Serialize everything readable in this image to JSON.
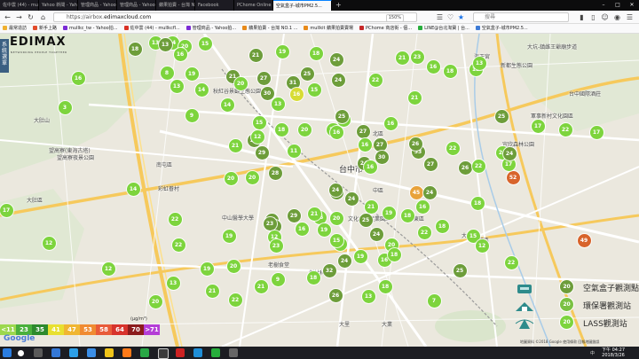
{
  "browser": {
    "tabs": [
      {
        "label": "佐中雲 (44) - mullkcha@g..."
      },
      {
        "label": "Yahoo 新聞 - Yahoo新聞..."
      },
      {
        "label": "管理商品 - Yahoo拍賣..."
      },
      {
        "label": "管理商品 - Yahoo拍賣..."
      },
      {
        "label": "蘋果拍賣 - 台灣 NO.1 拍賣..."
      },
      {
        "label": "Facebook"
      },
      {
        "label": "PChome Online 網路家庭..."
      },
      {
        "label": "空氣盒子-城市PM2.5...",
        "active": true
      }
    ],
    "url_prefix": "https://airbox.",
    "url_host": "edimaxcloud.com",
    "zoom": "150%",
    "search_placeholder": "搜尋",
    "bookmarks": [
      {
        "label": "最常造訪",
        "color": "#f0b030"
      },
      {
        "label": "新手上路",
        "color": "#e24b2b"
      },
      {
        "label": "mullkc_tw - Yahoo拍...",
        "color": "#7b2bd6"
      },
      {
        "label": "佐中雲 (44) - mullkcfl...",
        "color": "#d93025"
      },
      {
        "label": "管理商品 - Yahoo拍...",
        "color": "#7b2bd6"
      },
      {
        "label": "蘋果拍賣 - 台灣 NO.1 ...",
        "color": "#e88a1a"
      },
      {
        "label": "mullkit 蘋果拍賣賣場",
        "color": "#e88a1a"
      },
      {
        "label": "PChome 商店街 - 個...",
        "color": "#c62828"
      },
      {
        "label": "LINE@台北淘寶 | 台...",
        "color": "#27ae3c"
      },
      {
        "label": "空氣盒子-城市PM2.5...",
        "color": "#3e7bd6"
      }
    ]
  },
  "page": {
    "brand": "EDIMAX",
    "brand_tagline": "NETWORKING PEOPLE TOGETHER",
    "side_tab": "系統選單"
  },
  "map_labels": [
    {
      "text": "大坑-鎮雌王爺廟步道",
      "size": "s"
    },
    {
      "text": "新都生態公園",
      "size": "s"
    },
    {
      "text": "海天宮",
      "size": "s"
    },
    {
      "text": "台中國際酒莊",
      "size": "s"
    },
    {
      "text": "軍事新村文化園區",
      "size": "s"
    },
    {
      "text": "大肚山",
      "size": "s"
    },
    {
      "text": "望高寮(東海古塔)",
      "size": "s"
    },
    {
      "text": "望高寮夜景公園",
      "size": "s"
    },
    {
      "text": "南屯區",
      "size": "s"
    },
    {
      "text": "彩虹眷村",
      "size": "s"
    },
    {
      "text": "大肚區",
      "size": "s"
    },
    {
      "text": "台中市",
      "size": "l"
    },
    {
      "text": "北區",
      "size": "s"
    },
    {
      "text": "中區",
      "size": "s"
    },
    {
      "text": "秋紅谷景觀生態公園",
      "size": "s"
    },
    {
      "text": "中山醫學大學",
      "size": "s"
    },
    {
      "text": "文化創意產業園區",
      "size": "s"
    },
    {
      "text": "東區",
      "size": "s"
    },
    {
      "text": "大里區",
      "size": "s"
    },
    {
      "text": "大平區",
      "size": "s"
    },
    {
      "text": "老樹食堂",
      "size": "s"
    },
    {
      "text": "樹林科技",
      "size": "s"
    },
    {
      "text": "大里",
      "size": "s"
    },
    {
      "text": "宜欣森林公園",
      "size": "s"
    },
    {
      "text": "大業",
      "size": "s"
    }
  ],
  "stations": [
    {
      "v": "18",
      "t": "box"
    },
    {
      "v": "13",
      "t": "lass"
    },
    {
      "v": "14",
      "t": "lass"
    },
    {
      "v": "20",
      "t": "lass"
    },
    {
      "v": "13",
      "t": "box"
    },
    {
      "v": "16",
      "t": "lass"
    },
    {
      "v": "15",
      "t": "lass"
    },
    {
      "v": "21",
      "t": "box"
    },
    {
      "v": "19",
      "t": "lass"
    },
    {
      "v": "18",
      "t": "lass"
    },
    {
      "v": "24",
      "t": "box"
    },
    {
      "v": "23",
      "t": "lass"
    },
    {
      "v": "21",
      "t": "lass"
    },
    {
      "v": "16",
      "t": "lass"
    },
    {
      "v": "24",
      "t": "box"
    },
    {
      "v": "22",
      "t": "lass"
    },
    {
      "v": "21",
      "t": "lass"
    },
    {
      "v": "18",
      "t": "lass"
    },
    {
      "v": "15",
      "t": "lass"
    },
    {
      "v": "13",
      "t": "lass"
    },
    {
      "v": "16",
      "t": "lass"
    },
    {
      "v": "3",
      "t": "lass"
    },
    {
      "v": "8",
      "t": "lass"
    },
    {
      "v": "19",
      "t": "lass"
    },
    {
      "v": "14",
      "t": "lass"
    },
    {
      "v": "21",
      "t": "box"
    },
    {
      "v": "27",
      "t": "box"
    },
    {
      "v": "30",
      "t": "box"
    },
    {
      "v": "31",
      "t": "box"
    },
    {
      "v": "16",
      "t": "yel"
    },
    {
      "v": "25",
      "t": "box"
    },
    {
      "v": "13",
      "t": "lass"
    },
    {
      "v": "14",
      "t": "lass"
    },
    {
      "v": "20",
      "t": "lass"
    },
    {
      "v": "15",
      "t": "lass"
    },
    {
      "v": "13",
      "t": "lass"
    },
    {
      "v": "18",
      "t": "lass"
    },
    {
      "v": "20",
      "t": "lass"
    },
    {
      "v": "15",
      "t": "lass"
    },
    {
      "v": "15",
      "t": "lass"
    },
    {
      "v": "9",
      "t": "lass"
    },
    {
      "v": "15",
      "t": "lass"
    },
    {
      "v": "25",
      "t": "box"
    },
    {
      "v": "16",
      "t": "lass"
    },
    {
      "v": "27",
      "t": "box"
    },
    {
      "v": "16",
      "t": "lass"
    },
    {
      "v": "25",
      "t": "box"
    },
    {
      "v": "17",
      "t": "lass"
    },
    {
      "v": "22",
      "t": "lass"
    },
    {
      "v": "24",
      "t": "lass"
    },
    {
      "v": "17",
      "t": "lass"
    },
    {
      "v": "26",
      "t": "box"
    },
    {
      "v": "33",
      "t": "box"
    },
    {
      "v": "21",
      "t": "lass"
    },
    {
      "v": "28",
      "t": "box"
    },
    {
      "v": "12",
      "t": "lass"
    },
    {
      "v": "29",
      "t": "box"
    },
    {
      "v": "11",
      "t": "lass"
    },
    {
      "v": "16",
      "t": "lass"
    },
    {
      "v": "27",
      "t": "box"
    },
    {
      "v": "22",
      "t": "lass"
    },
    {
      "v": "26",
      "t": "box"
    },
    {
      "v": "24",
      "t": "box"
    },
    {
      "v": "30",
      "t": "box"
    },
    {
      "v": "22",
      "t": "lass"
    },
    {
      "v": "52",
      "t": "org"
    },
    {
      "v": "17",
      "t": "lass"
    },
    {
      "v": "14",
      "t": "lass"
    },
    {
      "v": "12",
      "t": "lass"
    },
    {
      "v": "22",
      "t": "lass"
    },
    {
      "v": "20",
      "t": "lass"
    },
    {
      "v": "20",
      "t": "lass"
    },
    {
      "v": "28",
      "t": "box"
    },
    {
      "v": "31",
      "t": "box"
    },
    {
      "v": "24",
      "t": "box"
    },
    {
      "v": "45",
      "t": "amb"
    },
    {
      "v": "24",
      "t": "box"
    },
    {
      "v": "16",
      "t": "lass"
    },
    {
      "v": "27",
      "t": "box"
    },
    {
      "v": "16",
      "t": "lass"
    },
    {
      "v": "21",
      "t": "lass"
    },
    {
      "v": "18",
      "t": "lass"
    },
    {
      "v": "19",
      "t": "lass"
    },
    {
      "v": "20",
      "t": "lass"
    },
    {
      "v": "22",
      "t": "lass"
    },
    {
      "v": "27",
      "t": "box"
    },
    {
      "v": "29",
      "t": "box"
    },
    {
      "v": "16",
      "t": "lass"
    },
    {
      "v": "20",
      "t": "lass"
    },
    {
      "v": "24",
      "t": "box"
    },
    {
      "v": "21",
      "t": "lass"
    },
    {
      "v": "19",
      "t": "lass"
    },
    {
      "v": "18",
      "t": "lass"
    },
    {
      "v": "15",
      "t": "lass"
    },
    {
      "v": "18",
      "t": "lass"
    },
    {
      "v": "18",
      "t": "lass"
    },
    {
      "v": "49",
      "t": "org"
    },
    {
      "v": "22",
      "t": "lass"
    },
    {
      "v": "12",
      "t": "lass"
    },
    {
      "v": "19",
      "t": "lass"
    },
    {
      "v": "20",
      "t": "lass"
    },
    {
      "v": "19",
      "t": "lass"
    },
    {
      "v": "13",
      "t": "lass"
    },
    {
      "v": "27",
      "t": "box"
    },
    {
      "v": "23",
      "t": "box"
    },
    {
      "v": "12",
      "t": "lass"
    },
    {
      "v": "16",
      "t": "lass"
    },
    {
      "v": "24",
      "t": "box"
    },
    {
      "v": "18",
      "t": "lass"
    },
    {
      "v": "32",
      "t": "box"
    },
    {
      "v": "26",
      "t": "box"
    },
    {
      "v": "19",
      "t": "lass"
    },
    {
      "v": "16",
      "t": "lass"
    },
    {
      "v": "13",
      "t": "lass"
    },
    {
      "v": "25",
      "t": "box"
    },
    {
      "v": "21",
      "t": "lass"
    },
    {
      "v": "9",
      "t": "lass"
    },
    {
      "v": "18",
      "t": "lass"
    },
    {
      "v": "24",
      "t": "box"
    },
    {
      "v": "18",
      "t": "lass"
    },
    {
      "v": "25",
      "t": "box"
    },
    {
      "v": "15",
      "t": "lass"
    },
    {
      "v": "12",
      "t": "lass"
    },
    {
      "v": "21",
      "t": "lass"
    },
    {
      "v": "23",
      "t": "lass"
    },
    {
      "v": "22",
      "t": "lass"
    },
    {
      "v": "20",
      "t": "lass"
    },
    {
      "v": "22",
      "t": "lass"
    },
    {
      "v": "7",
      "t": "lass"
    },
    {
      "v": "17",
      "t": "lass"
    },
    {
      "v": "24",
      "t": "box"
    }
  ],
  "legend": [
    {
      "label": "空氣盒子觀測點",
      "value": "20",
      "color": "#6d9d3a"
    },
    {
      "label": "環保署觀測站",
      "value": "20",
      "color": "#7ac143"
    },
    {
      "label": "LASS觀測站",
      "value": "20",
      "color": "#7dd43d"
    }
  ],
  "scale": {
    "unit": "(μg/m³)",
    "levels": [
      {
        "label": "<11",
        "color": "#9cd84e"
      },
      {
        "label": "23",
        "color": "#4ab03c"
      },
      {
        "label": "35",
        "color": "#2d8a2d"
      },
      {
        "label": "41",
        "color": "#e8e030"
      },
      {
        "label": "47",
        "color": "#f0b632"
      },
      {
        "label": "53",
        "color": "#f08b32"
      },
      {
        "label": "58",
        "color": "#e85b3a"
      },
      {
        "label": "64",
        "color": "#d7332c"
      },
      {
        "label": "70",
        "color": "#8c1c1c"
      },
      {
        "label": ">71",
        "color": "#b43dd6"
      }
    ]
  },
  "map_footer": {
    "google": "Google",
    "attribution": "地圖資料 ©2018 Google  使用條款  回報地圖錯誤"
  },
  "taskbar": {
    "time": "下午 04:27",
    "date": "2018/3/26",
    "lang": "中"
  }
}
